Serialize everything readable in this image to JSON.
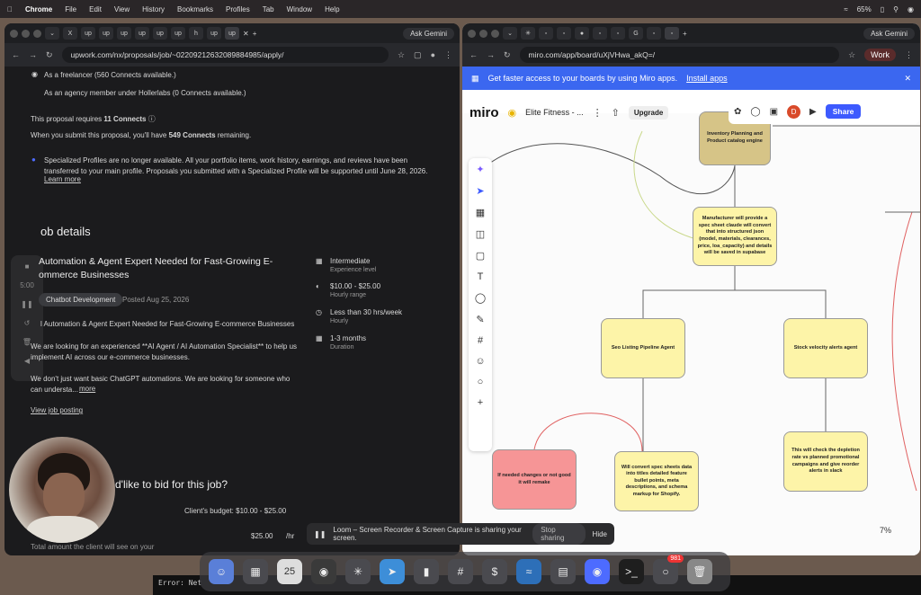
{
  "menubar": {
    "app": "Chrome",
    "items": [
      "File",
      "Edit",
      "View",
      "History",
      "Bookmarks",
      "Profiles",
      "Tab",
      "Window",
      "Help"
    ],
    "battery": "65%"
  },
  "left": {
    "tabs": [
      "X",
      "up",
      "up",
      "up",
      "up",
      "up",
      "up",
      "h",
      "up",
      "up"
    ],
    "ask": "Ask Gemini",
    "url": "upwork.com/nx/proposals/job/~02209212632089884985/apply/",
    "radio1": "As a freelancer (560 Connects available.)",
    "radio2": "As an agency member under Hollerlabs (0 Connects available.)",
    "req_pre": "This proposal requires ",
    "req_bold": "11 Connects",
    "submit_pre": "When you submit this proposal, you'll have ",
    "submit_bold": "549 Connects",
    "submit_post": " remaining.",
    "notice": "Specialized Profiles are no longer available. All your portfolio items, work history, earnings, and reviews have been transferred to your main profile. Proposals you submitted with a Specialized Profile will be supported until June 28, 2026.",
    "learn": "Learn more",
    "job_details": "ob details",
    "job_title": "Automation & Agent Expert Needed for Fast-Growing E-ommerce Businesses",
    "tag": "Chatbot Development",
    "posted": "Posted Aug 25, 2026",
    "desc_title": "l Automation & Agent Expert Needed for Fast-Growing E-commerce Businesses",
    "desc1": "We are looking for an experienced **AI Agent / AI Automation Specialist** to help us implement AI across our e-commerce businesses.",
    "desc2": "We don't just want basic ChatGPT automations. We are looking for someone who can understa...",
    "more": "more",
    "view": "View job posting",
    "meta": [
      {
        "t": "Intermediate",
        "s": "Experience level"
      },
      {
        "t": "$10.00 - $25.00",
        "s": "Hourly range"
      },
      {
        "t": "Less than 30 hrs/week",
        "s": "Hourly"
      },
      {
        "t": "1-3 months",
        "s": "Duration"
      }
    ],
    "bid": "d'like to bid for this job?",
    "budget": "Client's budget: $10.00 - $25.00",
    "rate": "$25.00",
    "per": "/hr",
    "total": "Total amount the client will see on your",
    "loom_time": "5:00"
  },
  "right": {
    "ask": "Ask Gemini",
    "url": "miro.com/app/board/uXjVHwa_akQ=/",
    "work": "Work",
    "banner": "Get faster access to your boards by using Miro apps.",
    "install": "Install apps",
    "logo": "miro",
    "board": "Elite Fitness - ...",
    "upgrade": "Upgrade",
    "share": "Share",
    "user": "D",
    "zoom": "7%",
    "nodes": {
      "n1": "Inventory Planning and Product catalog engine",
      "n2": "Manufacturer will provide a spec sheet claude will convert that into structured json (model, materials, clearances, price, loa_capacity) and details will be saved in supabase",
      "n3": "Seo Listing Pipeline Agent",
      "n4": "Stock velocity alerts agent",
      "n5": "If needed changes or not good it will remake",
      "n6": "Will convert spec sheets data into titles detailed feature bullet points, meta descriptions, and schema markup for Shopify.",
      "n7": "This will check the depletion rate vs planned promotional campaigns and give reorder alerts in slack"
    }
  },
  "loombar": {
    "msg": "Loom – Screen Recorder & Screen Capture is sharing your screen.",
    "stop": "Stop sharing",
    "hide": "Hide"
  },
  "dock": {
    "badge": "981",
    "date": "25"
  },
  "terminal": "Error: Net"
}
